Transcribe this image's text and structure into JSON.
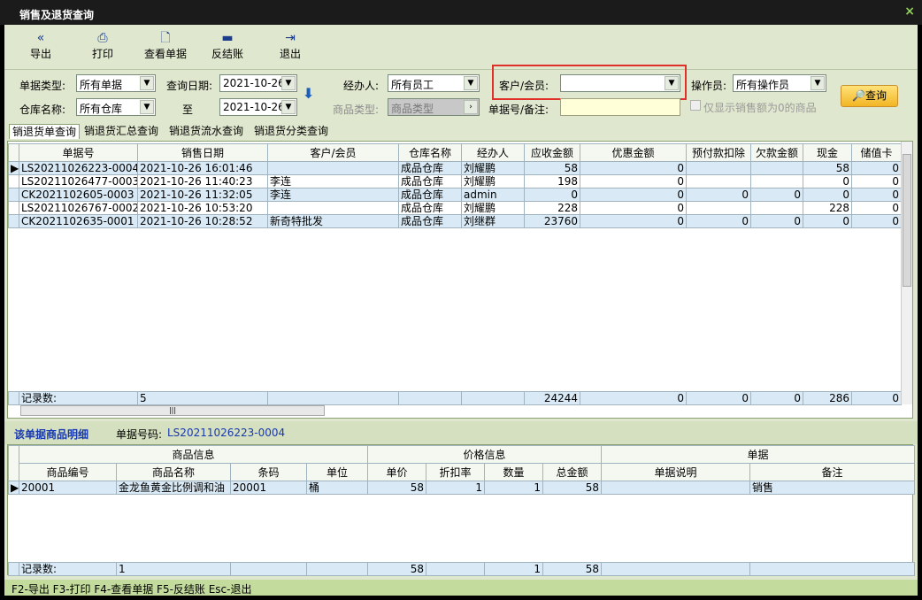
{
  "window": {
    "title": "销售及退货查询",
    "close": "×"
  },
  "toolbar": [
    {
      "label": "导出",
      "icon": "export-icon",
      "glyph": "«"
    },
    {
      "label": "打印",
      "icon": "print-icon",
      "glyph": "⎙"
    },
    {
      "label": "查看单据",
      "icon": "document-icon",
      "glyph": "🗋"
    },
    {
      "label": "反结账",
      "icon": "minus-icon",
      "glyph": "▬"
    },
    {
      "label": "退出",
      "icon": "exit-icon",
      "glyph": "⇥"
    }
  ],
  "filters": {
    "doc_type_label": "单据类型:",
    "doc_type": "所有单据",
    "date_label": "查询日期:",
    "date_from": "2021-10-26",
    "to_label": "至",
    "date_to": "2021-10-26",
    "handler_label": "经办人:",
    "handler": "所有员工",
    "customer_label": "客户/会员:",
    "customer": "",
    "operator_label": "操作员:",
    "operator": "所有操作员",
    "warehouse_label": "仓库名称:",
    "warehouse": "所有仓库",
    "goods_type_label": "商品类型:",
    "goods_type": "商品类型",
    "docno_label": "单据号/备注:",
    "docno": "",
    "only_zero_label": "仅显示销售额为0的商品",
    "query_label": "查询"
  },
  "tabs": [
    "销退货单查询",
    "销退货汇总查询",
    "销退货流水查询",
    "销退货分类查询"
  ],
  "main_table": {
    "headers": [
      "单据号",
      "销售日期",
      "客户/会员",
      "仓库名称",
      "经办人",
      "应收金额",
      "优惠金额",
      "预付款扣除",
      "欠款金额",
      "现金",
      "储值卡"
    ],
    "rows": [
      [
        "LS20211026223-0004",
        "2021-10-26 16:01:46",
        "",
        "成品仓库",
        "刘耀鹏",
        "58",
        "0",
        "",
        "",
        "58",
        "0"
      ],
      [
        "LS20211026477-0003",
        "2021-10-26 11:40:23",
        "李连",
        "成品仓库",
        "刘耀鹏",
        "198",
        "0",
        "",
        "",
        "0",
        "0"
      ],
      [
        "CK2021102605-0003",
        "2021-10-26 11:32:05",
        "李连",
        "成品仓库",
        "admin",
        "0",
        "0",
        "0",
        "0",
        "0",
        "0"
      ],
      [
        "LS20211026767-0002",
        "2021-10-26 10:53:20",
        "",
        "成品仓库",
        "刘耀鹏",
        "228",
        "0",
        "",
        "",
        "228",
        "0"
      ],
      [
        "CK2021102635-0001",
        "2021-10-26 10:28:52",
        "新奇特批发",
        "成品仓库",
        "刘继群",
        "23760",
        "0",
        "0",
        "0",
        "0",
        "0"
      ]
    ],
    "footer": [
      "记录数:",
      "5",
      "",
      "",
      "",
      "24244",
      "0",
      "0",
      "0",
      "286",
      "0"
    ]
  },
  "detail": {
    "title": "该单据商品明细",
    "docno_label": "单据号码:",
    "docno": "LS20211026223-0004",
    "groups": [
      "商品信息",
      "价格信息",
      "单据"
    ],
    "headers": [
      "商品编号",
      "商品名称",
      "条码",
      "单位",
      "单价",
      "折扣率",
      "数量",
      "总金额",
      "单据说明",
      "备注"
    ],
    "rows": [
      [
        "20001",
        "金龙鱼黄金比例调和油",
        "20001",
        "桶",
        "58",
        "1",
        "1",
        "58",
        "",
        "销售"
      ]
    ],
    "footer": [
      "记录数:",
      "1",
      "",
      "",
      "58",
      "",
      "1",
      "58",
      "",
      ""
    ]
  },
  "status": "F2-导出 F3-打印 F4-查看单据 F5-反结账 Esc-退出"
}
